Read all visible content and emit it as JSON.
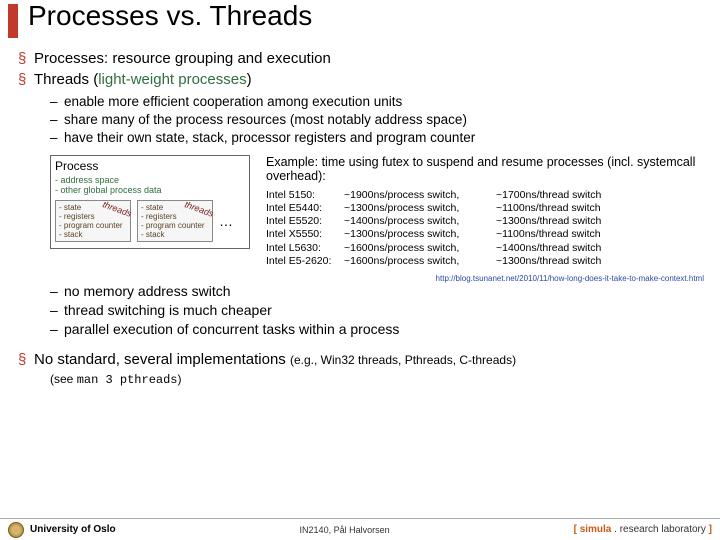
{
  "title": "Processes vs. Threads",
  "bullets": {
    "b1": "Processes: resource grouping and execution",
    "b2_pre": "Threads (",
    "b2_green": "light-weight processes",
    "b2_post": ")",
    "sub": {
      "s1": "enable more efficient cooperation among execution units",
      "s2": "share many of the process resources (most notably address space)",
      "s3": "have their own state, stack, processor registers and program counter"
    },
    "sub2": {
      "s1": "no memory address switch",
      "s2": "thread switching is much cheaper",
      "s3": "parallel execution of concurrent tasks within a process"
    },
    "b3_main": "No standard, several implementations ",
    "b3_eg": "(e.g., Win32 threads, Pthreads, C-threads)",
    "seeman_pre": "(see ",
    "seeman_code": "man 3 pthreads",
    "seeman_post": ")"
  },
  "process_box": {
    "header": "Process",
    "shared_l1": "- address space",
    "shared_l2": "- other global process data",
    "thread": {
      "l1": "- state",
      "l2": "- registers",
      "l3": "- program counter",
      "l4": "- stack",
      "label": "threads"
    },
    "dots": "…"
  },
  "example": {
    "title": "Example: time using futex to suspend and resume processes (incl. systemcall overhead):",
    "rows": [
      {
        "cpu": "Intel 5150:",
        "proc": "~1900ns/process switch,",
        "thr": "~1700ns/thread switch"
      },
      {
        "cpu": "Intel E5440:",
        "proc": "~1300ns/process switch,",
        "thr": "~1100ns/thread switch"
      },
      {
        "cpu": "Intel E5520:",
        "proc": "~1400ns/process switch,",
        "thr": "~1300ns/thread switch"
      },
      {
        "cpu": "Intel X5550:",
        "proc": "~1300ns/process switch,",
        "thr": "~1100ns/thread switch"
      },
      {
        "cpu": "Intel L5630:",
        "proc": "~1600ns/process switch,",
        "thr": "~1400ns/thread switch"
      },
      {
        "cpu": "Intel E5-2620:",
        "proc": "~1600ns/process switch,",
        "thr": "~1300ns/thread switch"
      }
    ],
    "source": "http://blog.tsunanet.net/2010/11/how-long-does-it-take-to-make-context.html"
  },
  "footer": {
    "uni": "University of Oslo",
    "course": "IN2140, Pål Halvorsen",
    "lab_open": "[ ",
    "lab_sim": "simula",
    "lab_rl": " . research laboratory ",
    "lab_close": "]"
  }
}
